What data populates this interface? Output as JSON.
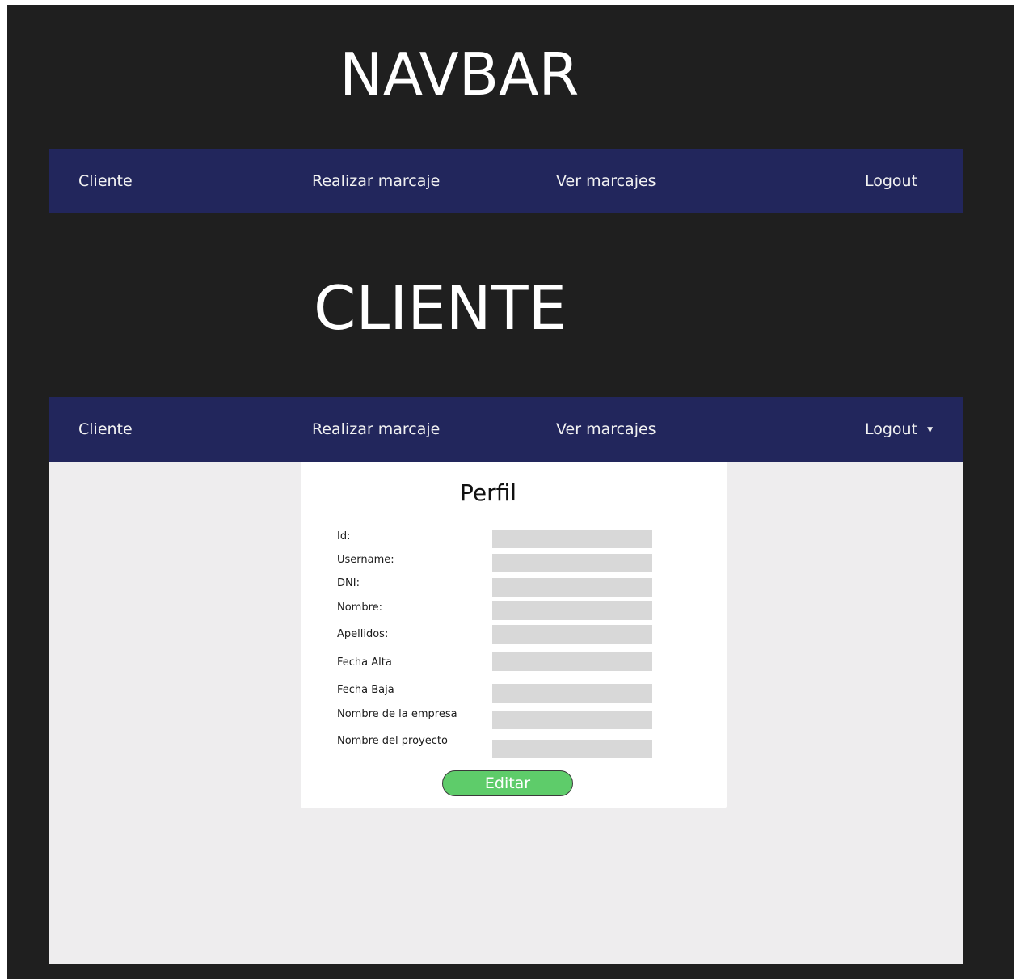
{
  "headings": {
    "navbar": "NAVBAR",
    "cliente": "CLIENTE"
  },
  "navbar_top": {
    "cliente": "Cliente",
    "realizar_marcaje": "Realizar marcaje",
    "ver_marcajes": "Ver marcajes",
    "logout": "Logout"
  },
  "navbar_bottom": {
    "cliente": "Cliente",
    "realizar_marcaje": "Realizar marcaje",
    "ver_marcajes": "Ver marcajes",
    "logout": "Logout",
    "logout_caret": "▼"
  },
  "profile": {
    "title": "Perfil",
    "fields": [
      {
        "label": "Id:",
        "value": ""
      },
      {
        "label": "Username:",
        "value": ""
      },
      {
        "label": "DNI:",
        "value": ""
      },
      {
        "label": "Nombre:",
        "value": ""
      },
      {
        "label": "Apellidos:",
        "value": ""
      },
      {
        "label": "Fecha Alta",
        "value": ""
      },
      {
        "label": "Fecha Baja",
        "value": ""
      },
      {
        "label": "Nombre de la empresa",
        "value": ""
      },
      {
        "label": "Nombre del proyecto",
        "value": ""
      }
    ],
    "edit_button": "Editar"
  },
  "colors": {
    "background": "#1f1f1f",
    "navbar": "#22265c",
    "content_area": "#eeedee",
    "card": "#ffffff",
    "input": "#d8d8d8",
    "edit_button": "#5ecc6a"
  }
}
